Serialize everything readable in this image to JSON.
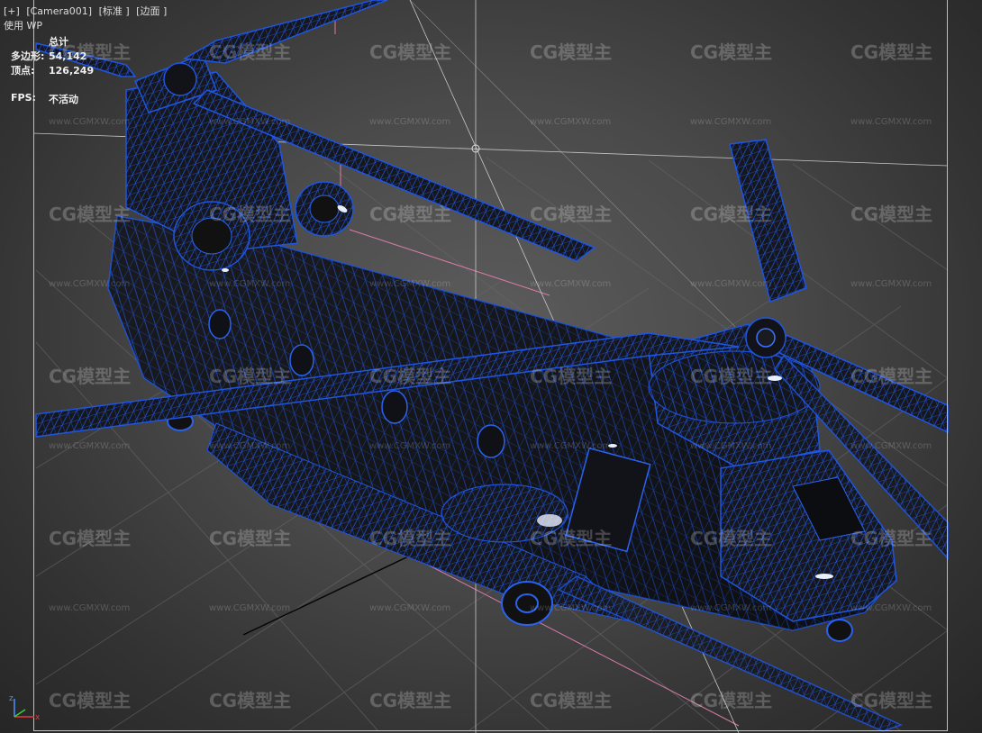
{
  "viewport": {
    "menu": [
      "[+]",
      "[Camera001]",
      "[标准 ]",
      "[边面 ]"
    ],
    "sub_label": "使用 WP"
  },
  "stats": {
    "header": "总计",
    "polys_label": "多边形:",
    "polys_value": "54,142",
    "verts_label": "顶点:",
    "verts_value": "126,249",
    "fps_label": "FPS:",
    "fps_value": "不活动"
  },
  "watermark": {
    "logo_text": "CG模型主",
    "url_text": "www.CGMXW.com"
  },
  "axis": {
    "x": "x",
    "z": "z"
  },
  "colors": {
    "wireframe": "#1e4fd8",
    "mesh_dark": "#15161a",
    "safe_frame": "#d8c84a",
    "grid_line": "#6a6a6a"
  }
}
